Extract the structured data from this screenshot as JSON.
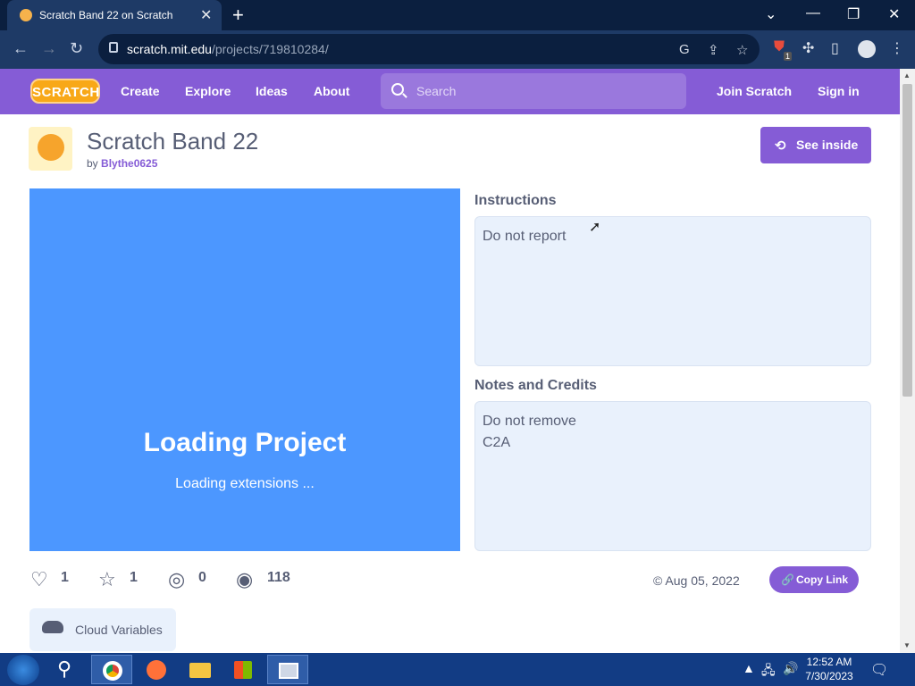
{
  "browser": {
    "tab_title": "Scratch Band 22 on Scratch",
    "tab_close": "✕",
    "new_tab": "+",
    "url_domain": "scratch.mit.edu",
    "url_path": "/projects/719810284/",
    "ext_badge": "1"
  },
  "scratch_nav": {
    "logo": "SCRATCH",
    "links": [
      "Create",
      "Explore",
      "Ideas",
      "About"
    ],
    "search_placeholder": "Search",
    "join": "Join Scratch",
    "signin": "Sign in"
  },
  "project": {
    "title": "Scratch Band 22",
    "by_prefix": "by",
    "author": "Blythe0625",
    "see_inside": "See inside",
    "loading_title": "Loading Project",
    "loading_sub": "Loading extensions ..."
  },
  "instructions": {
    "heading": "Instructions",
    "text": "Do not report"
  },
  "notes": {
    "heading": "Notes and Credits",
    "lines": [
      "Do not remove",
      "C2A"
    ]
  },
  "stats": {
    "loves": "1",
    "favorites": "1",
    "remixes": "0",
    "views": "118",
    "date": "© Aug 05, 2022",
    "copy_link": "Copy Link"
  },
  "tag": {
    "label": "Cloud Variables"
  },
  "taskbar": {
    "time": "12:52 AM",
    "date": "7/30/2023"
  },
  "colors": {
    "scratch_purple": "#855cd6",
    "stage_blue": "#4c97ff"
  }
}
